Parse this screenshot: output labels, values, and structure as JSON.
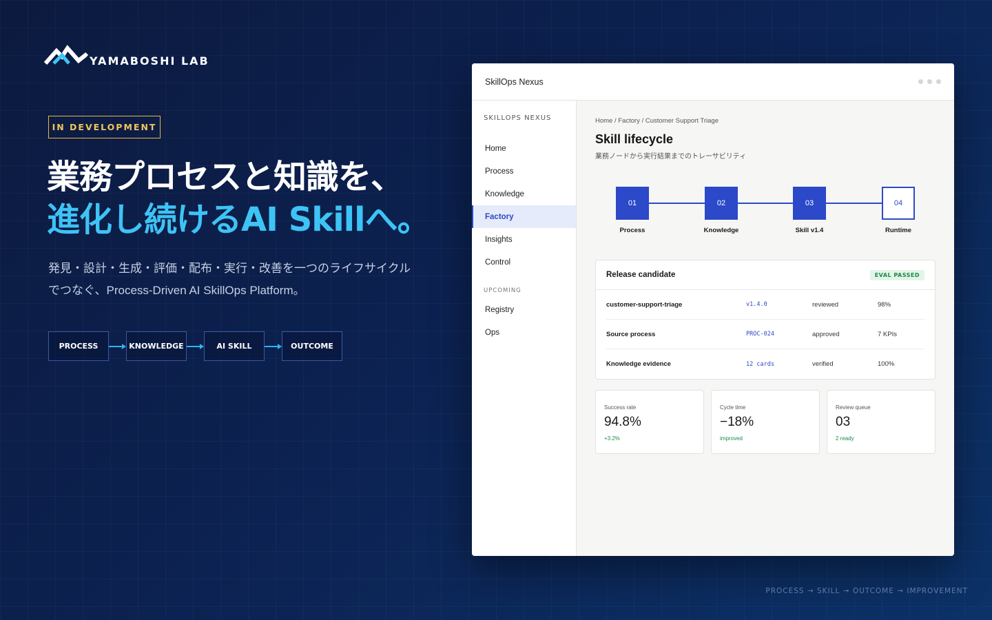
{
  "brand": {
    "name": "YAMABOSHI LAB",
    "logo_icon": "mountain-logo-icon"
  },
  "badge": "IN DEVELOPMENT",
  "headline": {
    "line1": "業務プロセスと知識を、",
    "line2": "進化し続けるAI Skillへ。"
  },
  "lead": {
    "line1": "発見・設計・生成・評価・配布・実行・改善を一つのライフサイクル",
    "line2": "でつなぐ、Process-Driven AI SkillOps Platform。"
  },
  "flow": [
    "PROCESS",
    "KNOWLEDGE",
    "AI SKILL",
    "OUTCOME"
  ],
  "footer_tag": "PROCESS → SKILL → OUTCOME → IMPROVEMENT",
  "colors": {
    "accent": "#2b49c9",
    "headline_accent": "#3ec3f5",
    "badge": "#e9b84a",
    "success": "#1b8a4a"
  },
  "app": {
    "window_title": "SkillOps Nexus",
    "sidebar": {
      "heading": "SKILLOPS NEXUS",
      "items": [
        {
          "label": "Home"
        },
        {
          "label": "Process"
        },
        {
          "label": "Knowledge"
        },
        {
          "label": "Factory",
          "active": true
        },
        {
          "label": "Insights"
        },
        {
          "label": "Control"
        }
      ],
      "upcoming_heading": "UPCOMING",
      "upcoming_items": [
        {
          "label": "Registry"
        },
        {
          "label": "Ops"
        }
      ]
    },
    "main": {
      "breadcrumb": "Home / Factory / Customer Support Triage",
      "title": "Skill lifecycle",
      "subtitle": "業務ノードから実行結果までのトレーサビリティ",
      "lifecycle": [
        {
          "num": "01",
          "label": "Process"
        },
        {
          "num": "02",
          "label": "Knowledge"
        },
        {
          "num": "03",
          "label": "Skill v1.4"
        },
        {
          "num": "04",
          "label": "Runtime"
        }
      ],
      "release": {
        "title": "Release candidate",
        "status": "EVAL PASSED",
        "rows": [
          {
            "name": "customer-support-triage",
            "ref": "v1.4.0",
            "state": "reviewed",
            "metric": "98%"
          },
          {
            "name": "Source process",
            "ref": "PROC-024",
            "state": "approved",
            "metric": "7 KPIs"
          },
          {
            "name": "Knowledge evidence",
            "ref": "12 cards",
            "state": "verified",
            "metric": "100%"
          }
        ]
      },
      "stats": [
        {
          "label": "Success rate",
          "value": "94.8%",
          "note": "+3.2%"
        },
        {
          "label": "Cycle time",
          "value": "−18%",
          "note": "improved"
        },
        {
          "label": "Review queue",
          "value": "03",
          "note": "2 ready"
        }
      ]
    }
  }
}
